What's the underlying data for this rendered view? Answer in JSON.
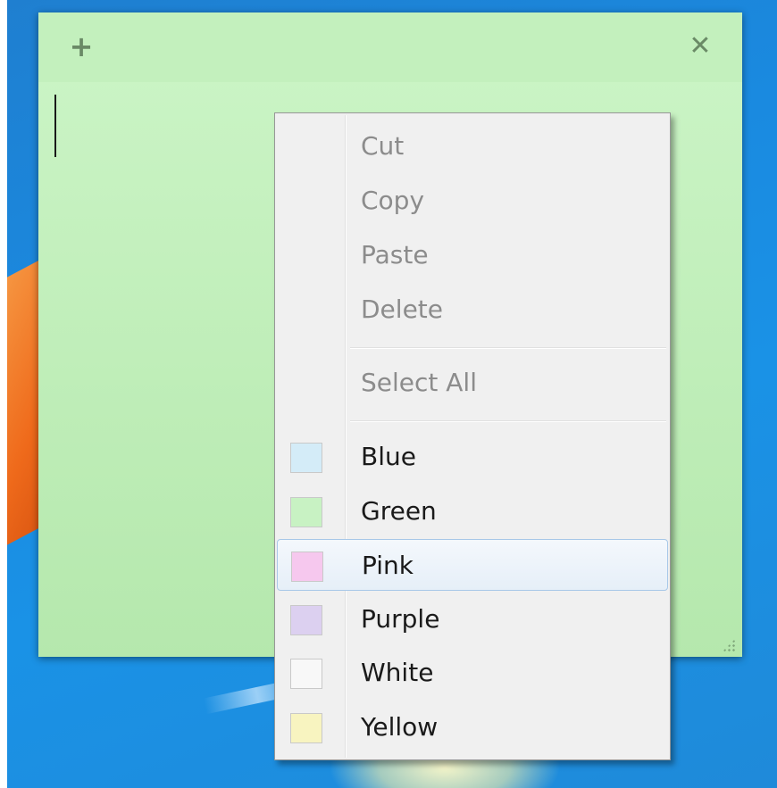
{
  "note": {
    "add_icon": "plus-icon",
    "close_icon": "close-icon",
    "add_glyph": "+",
    "close_glyph": "✕",
    "color": "#c3f0bd"
  },
  "context_menu": {
    "edit_items": [
      {
        "label": "Cut",
        "enabled": false
      },
      {
        "label": "Copy",
        "enabled": false
      },
      {
        "label": "Paste",
        "enabled": false
      },
      {
        "label": "Delete",
        "enabled": false
      }
    ],
    "select_all": {
      "label": "Select All",
      "enabled": false
    },
    "color_items": [
      {
        "label": "Blue",
        "swatch": "#d4ecf8"
      },
      {
        "label": "Green",
        "swatch": "#c8f2c3"
      },
      {
        "label": "Pink",
        "swatch": "#f6c8ee",
        "hovered": true
      },
      {
        "label": "Purple",
        "swatch": "#dcd0f0"
      },
      {
        "label": "White",
        "swatch": "#f8f8f8"
      },
      {
        "label": "Yellow",
        "swatch": "#f8f4c0"
      }
    ]
  }
}
